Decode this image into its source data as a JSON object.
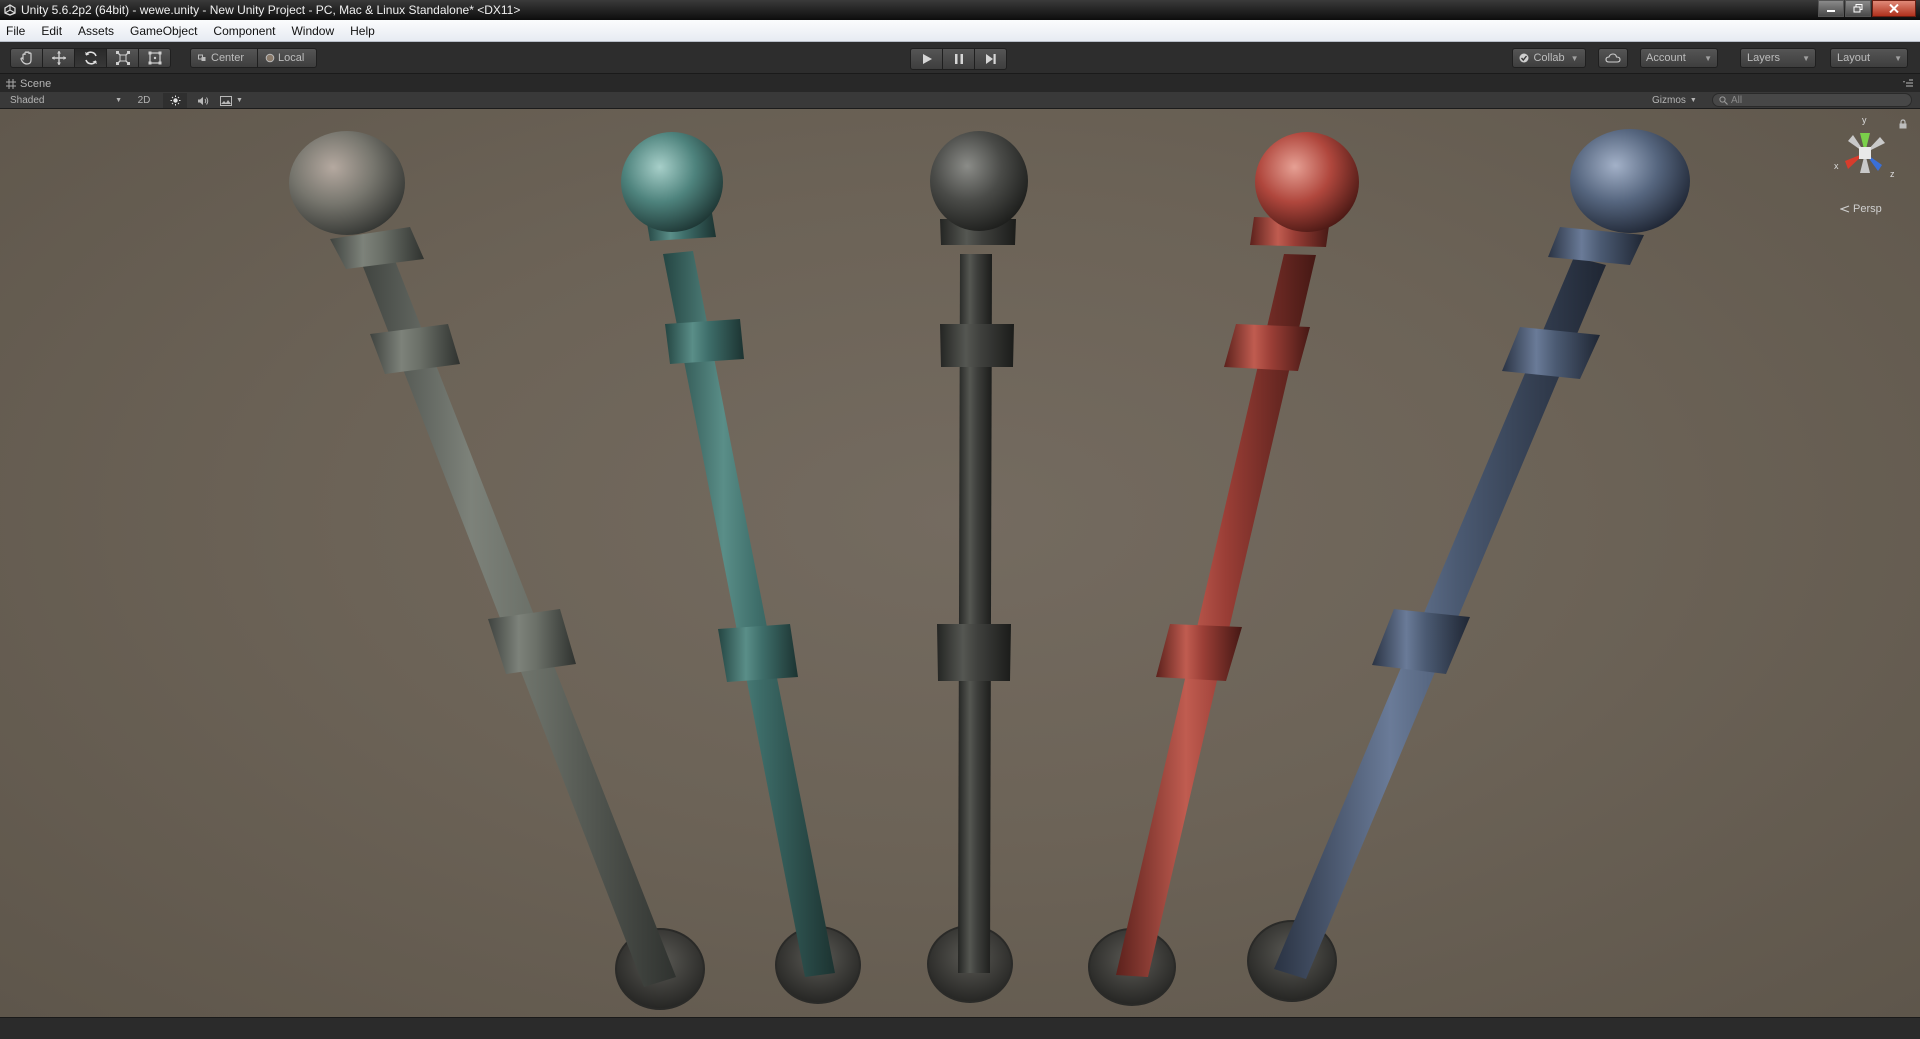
{
  "window": {
    "title": "Unity 5.6.2p2 (64bit) - wewe.unity - New Unity Project - PC, Mac & Linux Standalone* <DX11>"
  },
  "menu": [
    "File",
    "Edit",
    "Assets",
    "GameObject",
    "Component",
    "Window",
    "Help"
  ],
  "toolbar": {
    "tools": [
      "hand-tool",
      "move-tool",
      "rotate-tool",
      "scale-tool",
      "rect-tool"
    ],
    "active_tool": "rotate-tool",
    "pivot_mode": "Center",
    "pivot_rotation": "Local",
    "collab_label": "Collab",
    "account_label": "Account",
    "layers_label": "Layers",
    "layout_label": "Layout"
  },
  "scene": {
    "tab_label": "Scene",
    "draw_mode": "Shaded",
    "mode_2d": "2D",
    "gizmos_label": "Gizmos",
    "search_placeholder": "All",
    "projection_label": "Persp",
    "axis_labels": {
      "y": "y",
      "x": "x",
      "z": "z"
    }
  },
  "bollards": [
    {
      "name": "grey-bollard",
      "color": "#6b7068"
    },
    {
      "name": "teal-bollard",
      "color": "#3e6e6a"
    },
    {
      "name": "dark-bollard",
      "color": "#3f403d"
    },
    {
      "name": "red-bollard",
      "color": "#9a3e36"
    },
    {
      "name": "blue-bollard",
      "color": "#4b5a72"
    }
  ],
  "colors": {
    "viewport_bg": "#6c6357",
    "toolbar_bg": "#2d2d2d",
    "menubar_bg": "#f0f3f8",
    "close_button": "#c0402a"
  }
}
